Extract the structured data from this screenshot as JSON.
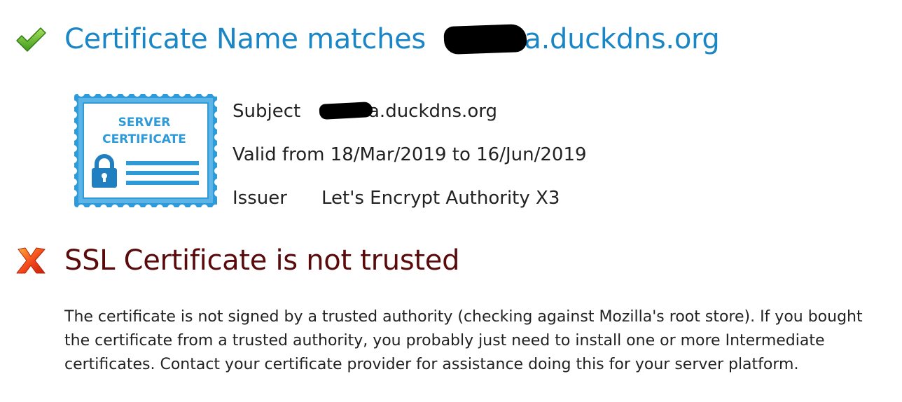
{
  "name_check": {
    "status": "pass",
    "title_prefix": "Certificate Name matches ",
    "title_domain_suffix": "a.duckdns.org",
    "icon": "checkmark-icon",
    "color": "#1a86c6"
  },
  "certificate": {
    "badge_line1": "SERVER",
    "badge_line2": "CERTIFICATE",
    "badge_icon": "server-certificate-icon",
    "subject_label": "Subject",
    "subject_value_suffix": "a.duckdns.org",
    "validity": "Valid from 18/Mar/2019 to 16/Jun/2019",
    "issuer_label": "Issuer",
    "issuer_value": "Let's Encrypt Authority X3"
  },
  "trust_check": {
    "status": "fail",
    "title": "SSL Certificate is not trusted",
    "icon": "cross-icon",
    "color": "#5a0a0a",
    "message": "The certificate is not signed by a trusted authority (checking against Mozilla's root store). If you bought the certificate from a trusted authority, you probably just need to install one or more Intermediate certificates. Contact your certificate provider for assistance doing this for your server platform."
  }
}
